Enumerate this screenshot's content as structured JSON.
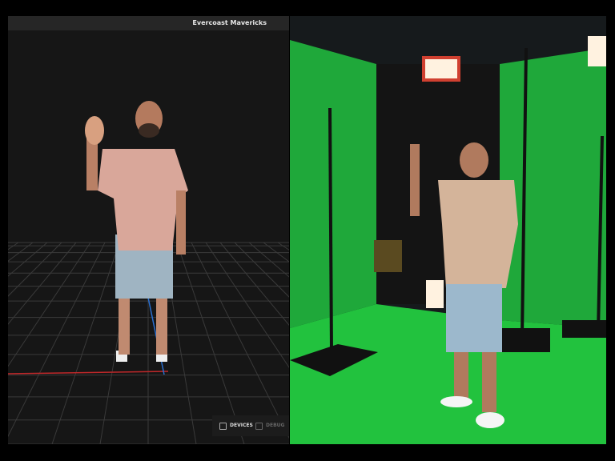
{
  "viewer": {
    "title": "Evercoast Mavericks",
    "toggles": [
      {
        "label": "DEVICES",
        "checked": false,
        "enabled": true
      },
      {
        "label": "DEBUG",
        "checked": false,
        "enabled": false
      }
    ]
  },
  "colors": {
    "grid": "#3a3a3a",
    "x_axis": "#c0282a",
    "z_axis": "#2a6fd0",
    "green_screen": "#1fa83a",
    "floor": "#22c23e"
  }
}
